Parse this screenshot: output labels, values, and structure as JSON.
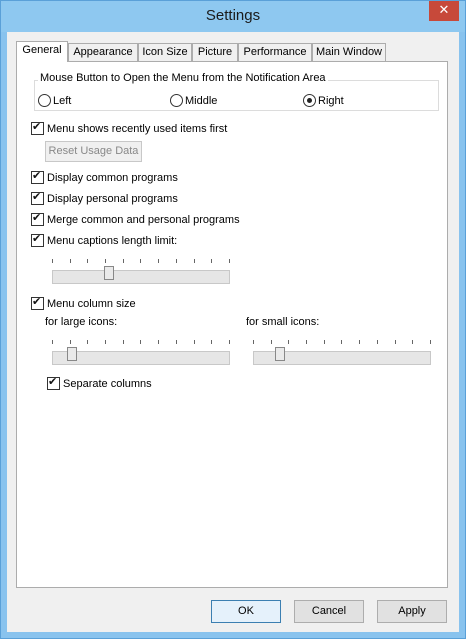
{
  "window": {
    "title": "Settings",
    "close_glyph": "✕"
  },
  "tabs": [
    {
      "label": "General",
      "active": true
    },
    {
      "label": "Appearance"
    },
    {
      "label": "Icon Size"
    },
    {
      "label": "Picture"
    },
    {
      "label": "Performance"
    },
    {
      "label": "Main Window"
    }
  ],
  "mouse_button_group": {
    "legend": "Mouse Button to Open the Menu from the Notification Area",
    "options": [
      "Left",
      "Middle",
      "Right"
    ],
    "selected": "Right"
  },
  "options": {
    "recent_first": {
      "label": "Menu shows recently used items first",
      "checked": true
    },
    "reset_usage": {
      "label": "Reset Usage Data",
      "enabled": false
    },
    "display_common": {
      "label": "Display common programs",
      "checked": true
    },
    "display_personal": {
      "label": "Display personal programs",
      "checked": true
    },
    "merge_programs": {
      "label": "Merge common and personal programs",
      "checked": true
    },
    "caption_limit": {
      "label": "Menu captions length limit:",
      "checked": true
    },
    "column_size": {
      "label": "Menu column size",
      "checked": true
    },
    "large_icons_label": "for large icons:",
    "small_icons_label": "for small icons:",
    "separate_columns": {
      "label": "Separate columns",
      "checked": true
    }
  },
  "sliders": {
    "caption_limit": {
      "fraction": 0.31
    },
    "large_icons": {
      "fraction": 0.09
    },
    "small_icons": {
      "fraction": 0.13
    }
  },
  "footer": {
    "ok": "OK",
    "cancel": "Cancel",
    "apply": "Apply"
  },
  "colors": {
    "titlebar": "#8ec8f0",
    "close": "#c7493a",
    "default_button_border": "#3c7fb1"
  }
}
